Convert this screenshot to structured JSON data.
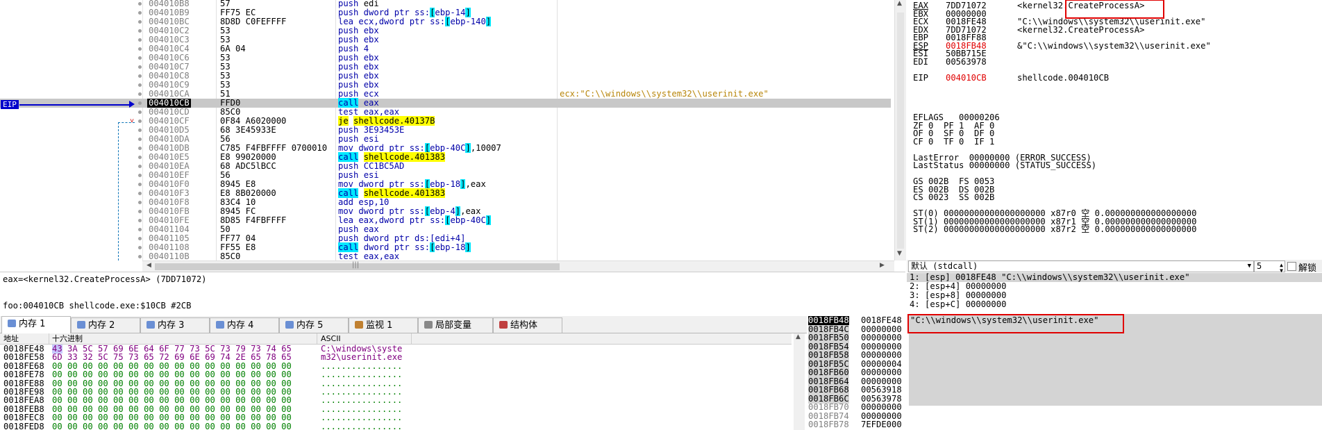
{
  "disasm": {
    "rows": [
      {
        "addr": "004010B8",
        "bytes": "57",
        "instr": [
          [
            "kw",
            "push "
          ],
          [
            "",
            "edi"
          ]
        ],
        "comment": ""
      },
      {
        "addr": "004010B9",
        "bytes": "FF75 EC",
        "instr": [
          [
            "kw",
            "push dword ptr ss:"
          ],
          [
            "brk",
            "["
          ],
          [
            "ptr",
            "ebp-14"
          ],
          [
            "brk",
            "]"
          ]
        ],
        "comment": ""
      },
      {
        "addr": "004010BC",
        "bytes": "8D8D C0FEFFFF",
        "instr": [
          [
            "kw",
            "lea ecx,dword ptr ss:"
          ],
          [
            "brk",
            "["
          ],
          [
            "ptr",
            "ebp-140"
          ],
          [
            "brk",
            "]"
          ]
        ],
        "comment": ""
      },
      {
        "addr": "004010C2",
        "bytes": "53",
        "instr": [
          [
            "kw",
            "push "
          ],
          [
            "ptr",
            "ebx"
          ]
        ],
        "comment": ""
      },
      {
        "addr": "004010C3",
        "bytes": "53",
        "instr": [
          [
            "kw",
            "push "
          ],
          [
            "ptr",
            "ebx"
          ]
        ],
        "comment": ""
      },
      {
        "addr": "004010C4",
        "bytes": "6A 04",
        "instr": [
          [
            "kw",
            "push "
          ],
          [
            "ptr",
            "4"
          ]
        ],
        "comment": ""
      },
      {
        "addr": "004010C6",
        "bytes": "53",
        "instr": [
          [
            "kw",
            "push "
          ],
          [
            "ptr",
            "ebx"
          ]
        ],
        "comment": ""
      },
      {
        "addr": "004010C7",
        "bytes": "53",
        "instr": [
          [
            "kw",
            "push "
          ],
          [
            "ptr",
            "ebx"
          ]
        ],
        "comment": ""
      },
      {
        "addr": "004010C8",
        "bytes": "53",
        "instr": [
          [
            "kw",
            "push "
          ],
          [
            "ptr",
            "ebx"
          ]
        ],
        "comment": ""
      },
      {
        "addr": "004010C9",
        "bytes": "53",
        "instr": [
          [
            "kw",
            "push "
          ],
          [
            "ptr",
            "ebx"
          ]
        ],
        "comment": ""
      },
      {
        "addr": "004010CA",
        "bytes": "51",
        "instr": [
          [
            "kw",
            "push "
          ],
          [
            "ptr",
            "ecx"
          ]
        ],
        "comment": "ecx:\"C:\\\\windows\\\\system32\\\\userinit.exe\""
      },
      {
        "addr": "004010CB",
        "bytes": "FFD0",
        "instr": [
          [
            "callk",
            "call"
          ],
          [
            "kw",
            " "
          ],
          [
            "ptr",
            "eax"
          ]
        ],
        "comment": "",
        "current": true
      },
      {
        "addr": "004010CD",
        "bytes": "85C0",
        "instr": [
          [
            "kw",
            "test "
          ],
          [
            "ptr",
            "eax,eax"
          ]
        ],
        "comment": ""
      },
      {
        "addr": "004010CF",
        "bytes": "0F84 A6020000",
        "instr": [
          [
            "jcc",
            "je"
          ],
          [
            "kw",
            " "
          ],
          [
            "tgt",
            "shellcode.40137B"
          ]
        ],
        "comment": "",
        "mark": "˅"
      },
      {
        "addr": "004010D5",
        "bytes": "68 3E45933E",
        "instr": [
          [
            "kw",
            "push "
          ],
          [
            "ptr",
            "3E93453E"
          ]
        ],
        "comment": ""
      },
      {
        "addr": "004010DA",
        "bytes": "56",
        "instr": [
          [
            "kw",
            "push "
          ],
          [
            "ptr",
            "esi"
          ]
        ],
        "comment": ""
      },
      {
        "addr": "004010DB",
        "bytes": "C785 F4FBFFFF 0700010",
        "instr": [
          [
            "kw",
            "mov dword ptr ss:"
          ],
          [
            "brk",
            "["
          ],
          [
            "ptr",
            "ebp-40C"
          ],
          [
            "brk",
            "]"
          ],
          [
            "num",
            ",10007"
          ]
        ],
        "comment": ""
      },
      {
        "addr": "004010E5",
        "bytes": "E8 99020000",
        "instr": [
          [
            "callk",
            "call"
          ],
          [
            "kw",
            " "
          ],
          [
            "tgt",
            "shellcode.401383"
          ]
        ],
        "comment": ""
      },
      {
        "addr": "004010EA",
        "bytes": "68 ADC5lBCC",
        "instr": [
          [
            "kw",
            "push "
          ],
          [
            "ptr",
            "CC1BC5AD"
          ]
        ],
        "comment": ""
      },
      {
        "addr": "004010EF",
        "bytes": "56",
        "instr": [
          [
            "kw",
            "push "
          ],
          [
            "ptr",
            "esi"
          ]
        ],
        "comment": ""
      },
      {
        "addr": "004010F0",
        "bytes": "8945 E8",
        "instr": [
          [
            "kw",
            "mov dword ptr ss:"
          ],
          [
            "brk",
            "["
          ],
          [
            "ptr",
            "ebp-18"
          ],
          [
            "brk",
            "]"
          ],
          [
            "num",
            ",eax"
          ]
        ],
        "comment": ""
      },
      {
        "addr": "004010F3",
        "bytes": "E8 8B020000",
        "instr": [
          [
            "callk",
            "call"
          ],
          [
            "kw",
            " "
          ],
          [
            "tgt",
            "shellcode.401383"
          ]
        ],
        "comment": ""
      },
      {
        "addr": "004010F8",
        "bytes": "83C4 10",
        "instr": [
          [
            "kw",
            "add "
          ],
          [
            "ptr",
            "esp,10"
          ]
        ],
        "comment": ""
      },
      {
        "addr": "004010FB",
        "bytes": "8945 FC",
        "instr": [
          [
            "kw",
            "mov dword ptr ss:"
          ],
          [
            "brk",
            "["
          ],
          [
            "ptr",
            "ebp-4"
          ],
          [
            "brk",
            "]"
          ],
          [
            "num",
            ",eax"
          ]
        ],
        "comment": ""
      },
      {
        "addr": "004010FE",
        "bytes": "8D85 F4FBFFFF",
        "instr": [
          [
            "kw",
            "lea eax,dword ptr ss:"
          ],
          [
            "brk",
            "["
          ],
          [
            "ptr",
            "ebp-40C"
          ],
          [
            "brk",
            "]"
          ]
        ],
        "comment": ""
      },
      {
        "addr": "00401104",
        "bytes": "50",
        "instr": [
          [
            "kw",
            "push "
          ],
          [
            "ptr",
            "eax"
          ]
        ],
        "comment": ""
      },
      {
        "addr": "00401105",
        "bytes": "FF77 04",
        "instr": [
          [
            "kw",
            "push dword ptr ds:"
          ],
          [
            "ptr",
            "[edi+4]"
          ]
        ],
        "comment": ""
      },
      {
        "addr": "00401108",
        "bytes": "FF55 E8",
        "instr": [
          [
            "callk",
            "call"
          ],
          [
            "kw",
            " dword ptr ss:"
          ],
          [
            "brk",
            "["
          ],
          [
            "ptr",
            "ebp-18"
          ],
          [
            "brk",
            "]"
          ]
        ],
        "comment": ""
      },
      {
        "addr": "0040110B",
        "bytes": "85C0",
        "instr": [
          [
            "kw",
            "test "
          ],
          [
            "ptr",
            "eax,eax"
          ]
        ],
        "comment": ""
      }
    ],
    "eip_label": "EIP"
  },
  "registers": {
    "rows": [
      {
        "name": "EAX",
        "value": "7DD71072",
        "comment": "<kernel32.CreateProcessA>",
        "name_ul": true
      },
      {
        "name": "EBX",
        "value": "00000000",
        "comment": ""
      },
      {
        "name": "ECX",
        "value": "0018FE48",
        "comment": "\"C:\\\\windows\\\\system32\\\\userinit.exe\""
      },
      {
        "name": "EDX",
        "value": "7DD71072",
        "comment": "<kernel32.CreateProcessA>"
      },
      {
        "name": "EBP",
        "value": "0018FF88",
        "comment": ""
      },
      {
        "name": "ESP",
        "value": "0018FB48",
        "comment": "&\"C:\\\\windows\\\\system32\\\\userinit.exe\"",
        "name_ul": true,
        "red": true
      },
      {
        "name": "ESI",
        "value": "50BB715E",
        "comment": ""
      },
      {
        "name": "EDI",
        "value": "00563978",
        "comment": ""
      },
      {
        "name": "",
        "value": "",
        "comment": ""
      },
      {
        "name": "EIP",
        "value": "004010CB",
        "comment": "shellcode.004010CB",
        "red": true
      }
    ],
    "flags_lines": [
      "EFLAGS   00000206",
      "ZF 0  PF 1  AF 0",
      "OF 0  SF 0  DF 0",
      "CF 0  TF 0  IF 1",
      "",
      "LastError  00000000 (ERROR_SUCCESS)",
      "LastStatus 00000000 (STATUS_SUCCESS)",
      "",
      "GS 002B  FS 0053",
      "ES 002B  DS 002B",
      "CS 0023  SS 002B",
      "",
      "ST(0) 00000000000000000000 x87r0 空 0.000000000000000000",
      "ST(1) 00000000000000000000 x87r1 空 0.000000000000000000",
      "ST(2) 00000000000000000000 x87r2 空 0.000000000000000000"
    ]
  },
  "info": {
    "line1": "eax=<kernel32.CreateProcessA> (7DD71072)",
    "line2": "foo:004010CB shellcode.exe:$10CB #2CB"
  },
  "callstack": {
    "convention": "默认 (stdcall)",
    "count": "5",
    "unlock_label": "解锁",
    "args": [
      "1: [esp] 0018FE48 \"C:\\\\windows\\\\system32\\\\userinit.exe\"",
      "2: [esp+4] 00000000",
      "3: [esp+8] 00000000",
      "4: [esp+C] 00000000"
    ]
  },
  "tabs": [
    {
      "label": "内存 1",
      "active": true
    },
    {
      "label": "内存 2"
    },
    {
      "label": "内存 3"
    },
    {
      "label": "内存 4"
    },
    {
      "label": "内存 5"
    },
    {
      "label": "监视 1"
    },
    {
      "label": "局部变量"
    },
    {
      "label": "结构体"
    }
  ],
  "memory": {
    "headers": {
      "addr": "地址",
      "hex": "十六进制",
      "ascii": "ASCII"
    },
    "rows": [
      {
        "addr": "0018FE48",
        "hex": "43 3A 5C 57 69 6E 64 6F 77 73 5C 73 79 73 74 65",
        "ascii": "C:\\windows\\syste",
        "z": false
      },
      {
        "addr": "0018FE58",
        "hex": "6D 33 32 5C 75 73 65 72 69 6E 69 74 2E 65 78 65",
        "ascii": "m32\\userinit.exe",
        "z": false
      },
      {
        "addr": "0018FE68",
        "hex": "00 00 00 00 00 00 00 00 00 00 00 00 00 00 00 00",
        "ascii": "................",
        "z": true
      },
      {
        "addr": "0018FE78",
        "hex": "00 00 00 00 00 00 00 00 00 00 00 00 00 00 00 00",
        "ascii": "................",
        "z": true
      },
      {
        "addr": "0018FE88",
        "hex": "00 00 00 00 00 00 00 00 00 00 00 00 00 00 00 00",
        "ascii": "................",
        "z": true
      },
      {
        "addr": "0018FE98",
        "hex": "00 00 00 00 00 00 00 00 00 00 00 00 00 00 00 00",
        "ascii": "................",
        "z": true
      },
      {
        "addr": "0018FEA8",
        "hex": "00 00 00 00 00 00 00 00 00 00 00 00 00 00 00 00",
        "ascii": "................",
        "z": true
      },
      {
        "addr": "0018FEB8",
        "hex": "00 00 00 00 00 00 00 00 00 00 00 00 00 00 00 00",
        "ascii": "................",
        "z": true
      },
      {
        "addr": "0018FEC8",
        "hex": "00 00 00 00 00 00 00 00 00 00 00 00 00 00 00 00",
        "ascii": "................",
        "z": true
      },
      {
        "addr": "0018FED8",
        "hex": "00 00 00 00 00 00 00 00 00 00 00 00 00 00 00 00",
        "ascii": "................",
        "z": true
      }
    ]
  },
  "stack": {
    "rows": [
      {
        "addr": "0018FB48",
        "value": "0018FE48",
        "comment": "\"C:\\\\windows\\\\system32\\\\userinit.exe\"",
        "current": true
      },
      {
        "addr": "0018FB4C",
        "value": "00000000",
        "comment": "",
        "hl": true
      },
      {
        "addr": "0018FB50",
        "value": "00000000",
        "comment": "",
        "hl": true
      },
      {
        "addr": "0018FB54",
        "value": "00000000",
        "comment": "",
        "hl": true
      },
      {
        "addr": "0018FB58",
        "value": "00000000",
        "comment": "",
        "hl": true
      },
      {
        "addr": "0018FB5C",
        "value": "00000004",
        "comment": "",
        "hl": true
      },
      {
        "addr": "0018FB60",
        "value": "00000000",
        "comment": "",
        "hl": true
      },
      {
        "addr": "0018FB64",
        "value": "00000000",
        "comment": "",
        "hl": true
      },
      {
        "addr": "0018FB68",
        "value": "00563918",
        "comment": "",
        "hl": true
      },
      {
        "addr": "0018FB6C",
        "value": "00563978",
        "comment": "",
        "hl": true
      },
      {
        "addr": "0018FB70",
        "value": "00000000",
        "comment": ""
      },
      {
        "addr": "0018FB74",
        "value": "00000000",
        "comment": ""
      },
      {
        "addr": "0018FB78",
        "value": "7EFDE000",
        "comment": ""
      }
    ]
  },
  "colors": {
    "highlight_box": "#e00000",
    "eip_arrow": "#0000cc",
    "call": "#00e8ff",
    "jump": "#ffff00"
  }
}
